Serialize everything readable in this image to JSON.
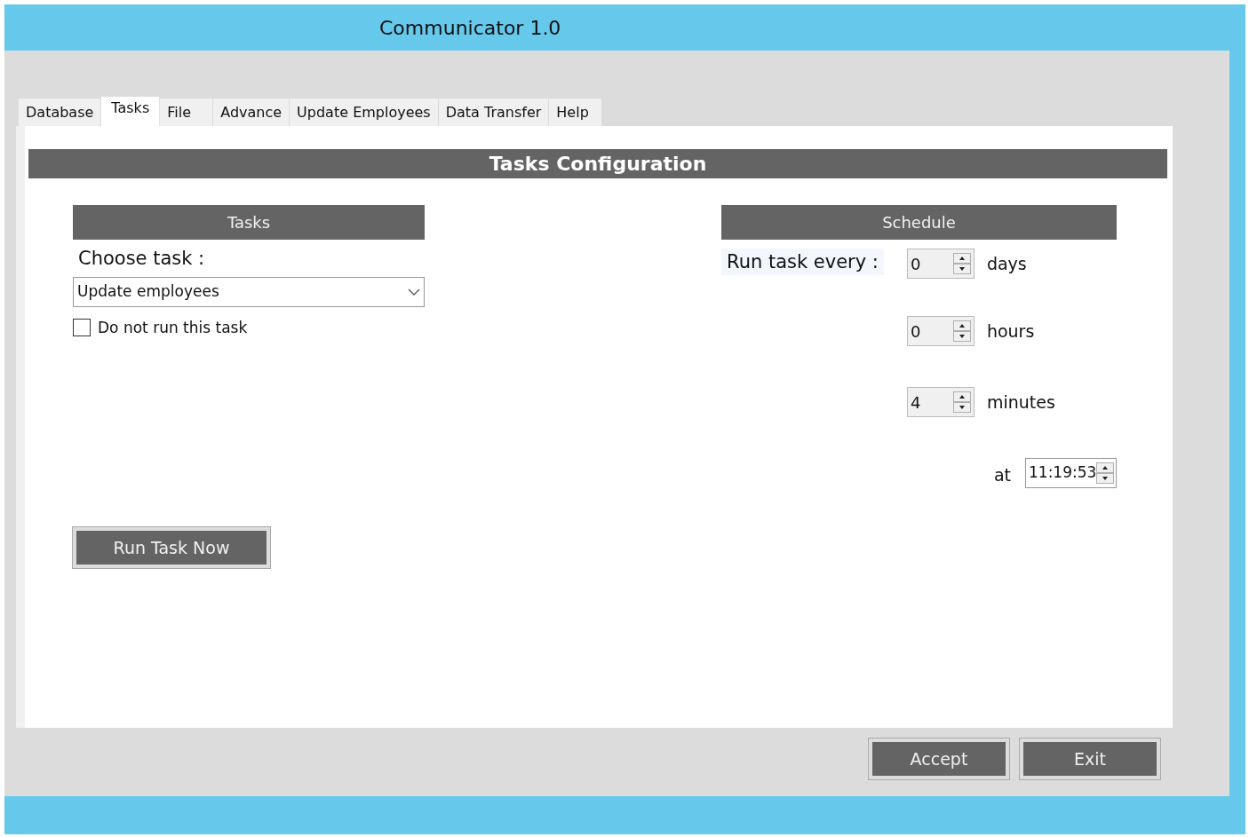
{
  "window": {
    "title": "Communicator 1.0"
  },
  "tabs": [
    {
      "label": "Database",
      "selected": false
    },
    {
      "label": "Tasks",
      "selected": true
    },
    {
      "label": "File",
      "selected": false
    },
    {
      "label": "Advance",
      "selected": false
    },
    {
      "label": "Update Employees",
      "selected": false
    },
    {
      "label": "Data Transfer",
      "selected": false
    },
    {
      "label": "Help",
      "selected": false
    }
  ],
  "panel_title": "Tasks Configuration",
  "tasks": {
    "header": "Tasks",
    "choose_label": "Choose task :",
    "task_value": "Update employees",
    "skip_label": "Do not run this task",
    "skip_checked": false,
    "run_button": "Run Task Now"
  },
  "schedule": {
    "header": "Schedule",
    "run_every_label": "Run task every :",
    "intervals": [
      {
        "value": "0",
        "unit": "days"
      },
      {
        "value": "0",
        "unit": "hours"
      },
      {
        "value": "4",
        "unit": "minutes"
      }
    ],
    "at_label": "at",
    "at_value": "11:19:53"
  },
  "buttons": [
    "Accept",
    "Exit"
  ]
}
